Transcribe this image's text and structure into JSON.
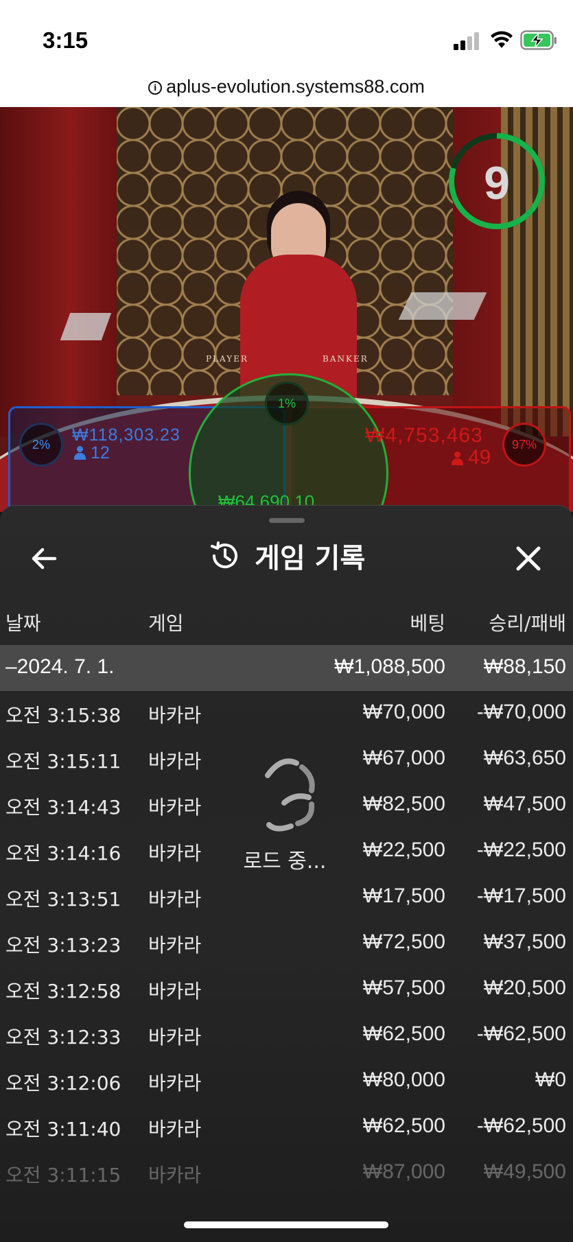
{
  "status_bar": {
    "time": "3:15"
  },
  "browser": {
    "url": "aplus-evolution.systems88.com",
    "info_icon": "i"
  },
  "video": {
    "timer_value": "9",
    "table_labels": {
      "player": "PLAYER",
      "banker": "BANKER"
    },
    "player": {
      "percent": "2%",
      "amount": "₩118,303.23",
      "users": "12",
      "color": "#3a7ee0"
    },
    "banker": {
      "percent": "97%",
      "amount": "₩4,753,463",
      "users": "49",
      "color": "#d01818"
    },
    "tie": {
      "percent": "1%",
      "amount": "₩64,690.10",
      "color": "#22c03a"
    }
  },
  "sheet": {
    "title": "게임 기록",
    "icons": {
      "back": "arrow-left-icon",
      "history": "history-icon",
      "close": "close-icon"
    },
    "columns": {
      "date": "날짜",
      "game": "게임",
      "bet": "베팅",
      "win_loss": "승리/패배"
    },
    "day_summary": {
      "date": "–2024. 7. 1.",
      "bet": "₩1,088,500",
      "win_loss": "₩88,150"
    },
    "rows": [
      {
        "time": "오전 3:15:38",
        "game": "바카라",
        "bet": "₩70,000",
        "win_loss": "-₩70,000"
      },
      {
        "time": "오전 3:15:11",
        "game": "바카라",
        "bet": "₩67,000",
        "win_loss": "₩63,650"
      },
      {
        "time": "오전 3:14:43",
        "game": "바카라",
        "bet": "₩82,500",
        "win_loss": "₩47,500"
      },
      {
        "time": "오전 3:14:16",
        "game": "바카라",
        "bet": "₩22,500",
        "win_loss": "-₩22,500"
      },
      {
        "time": "오전 3:13:51",
        "game": "바카라",
        "bet": "₩17,500",
        "win_loss": "-₩17,500"
      },
      {
        "time": "오전 3:13:23",
        "game": "바카라",
        "bet": "₩72,500",
        "win_loss": "₩37,500"
      },
      {
        "time": "오전 3:12:58",
        "game": "바카라",
        "bet": "₩57,500",
        "win_loss": "₩20,500"
      },
      {
        "time": "오전 3:12:33",
        "game": "바카라",
        "bet": "₩62,500",
        "win_loss": "-₩62,500"
      },
      {
        "time": "오전 3:12:06",
        "game": "바카라",
        "bet": "₩80,000",
        "win_loss": "₩0"
      },
      {
        "time": "오전 3:11:40",
        "game": "바카라",
        "bet": "₩62,500",
        "win_loss": "-₩62,500"
      },
      {
        "time": "오전 3:11:15",
        "game": "바카라",
        "bet": "₩87,000",
        "win_loss": "₩49,500"
      }
    ],
    "loading_text": "로드 중..."
  }
}
